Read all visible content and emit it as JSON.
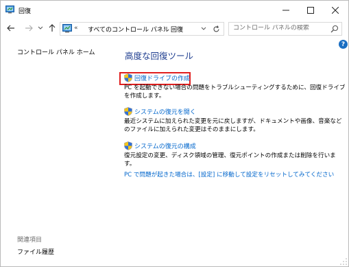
{
  "window": {
    "title": "回復",
    "controls": {
      "minimize": "–",
      "maximize": "□",
      "close": "✕"
    }
  },
  "nav": {
    "back": "←",
    "forward": "→",
    "recent": "⌄",
    "up": "↑",
    "address": {
      "overflow": "«",
      "crumbs": [
        "すべてのコントロール パネル",
        "回復"
      ],
      "separator": "›",
      "dropdown": "⌄",
      "refresh": "↻"
    },
    "search": {
      "placeholder": "コントロール パネルの検索"
    }
  },
  "left_pane": {
    "home_link": "コントロール パネル ホーム",
    "related_heading": "関連項目",
    "file_history_link": "ファイル履歴"
  },
  "main": {
    "help": "?",
    "title": "高度な回復ツール",
    "tasks": [
      {
        "link": "回復ドライブの作成",
        "description": "PC を起動できない場合の問題をトラブルシューティングするために、回復ドライブを作成します。",
        "icon": "shield-icon",
        "highlighted": true
      },
      {
        "link": "システムの復元を開く",
        "description": "最近システムに加えられた変更を元に戻しますが、ドキュメントや画像、音楽などのファイルに加えられた変更はそのままにします。",
        "icon": "shield-icon",
        "highlighted": false
      },
      {
        "link": "システムの復元の構成",
        "description": "復元設定の変更、ディスク領域の管理、復元ポイントの作成または削除を行います。",
        "icon": "shield-icon",
        "highlighted": false
      }
    ],
    "reset_link": "PC で問題が起きた場合は、[設定] に移動して設定をリセットしてみてください"
  },
  "colors": {
    "link": "#0066cc",
    "title": "#1e3d8f",
    "highlight": "#e01e1e",
    "help_bg": "#1a6ec2"
  }
}
